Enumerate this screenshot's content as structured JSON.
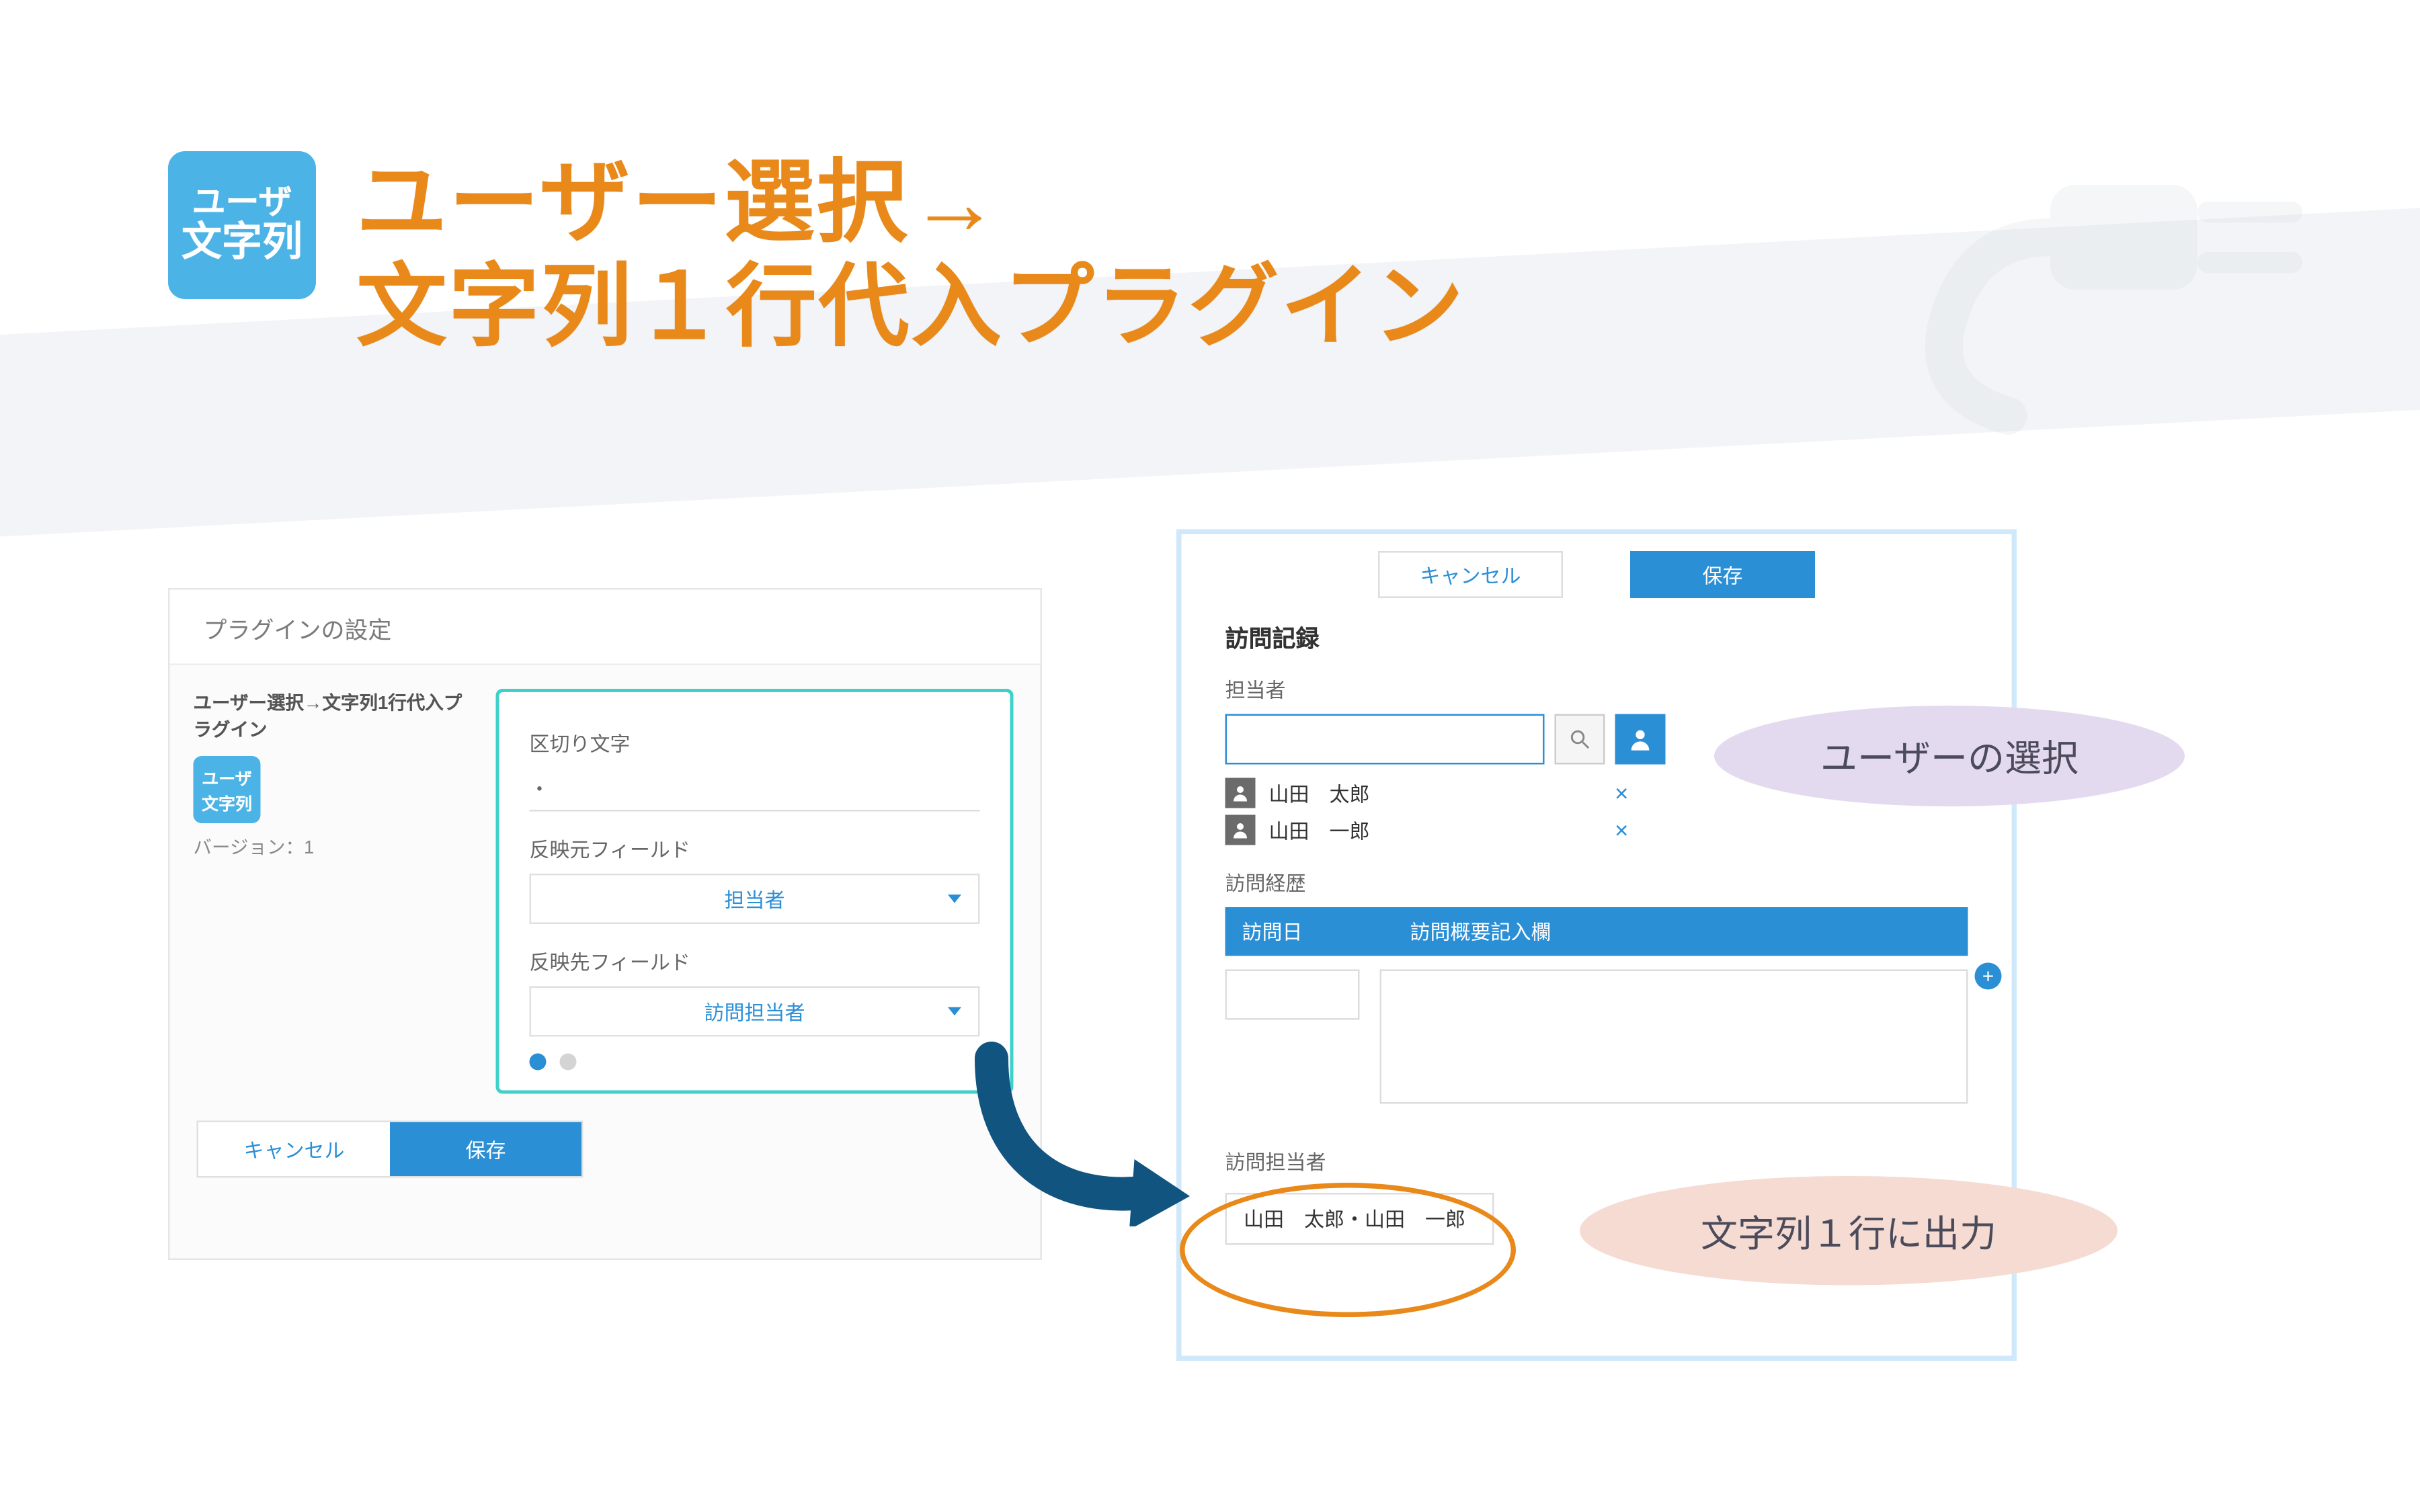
{
  "app_icon": {
    "line1": "ユーザ",
    "line2": "文字列"
  },
  "title": {
    "line1": "ユーザー選択→",
    "line2": "文字列１行代入プラグイン"
  },
  "settings_panel": {
    "header": "プラグインの設定",
    "plugin_name": "ユーザー選択→文字列1行代入プラグイン",
    "version_label": "バージョン：1",
    "separator_label": "区切り文字",
    "separator_value": "・",
    "source_field_label": "反映元フィールド",
    "source_field_value": "担当者",
    "target_field_label": "反映先フィールド",
    "target_field_value": "訪問担当者",
    "cancel_label": "キャンセル",
    "save_label": "保存"
  },
  "record_panel": {
    "cancel_label": "キャンセル",
    "save_label": "保存",
    "form_title": "訪問記録",
    "owner_label": "担当者",
    "users": [
      {
        "name": "山田　太郎"
      },
      {
        "name": "山田　一郎"
      }
    ],
    "history_label": "訪問経歴",
    "history_columns": {
      "date": "訪問日",
      "summary": "訪問概要記入欄"
    },
    "visit_owner_label": "訪問担当者",
    "visit_owner_value": "山田　太郎・山田　一郎"
  },
  "callouts": {
    "user_select": "ユーザーの選択",
    "string_output": "文字列１行に出力"
  }
}
